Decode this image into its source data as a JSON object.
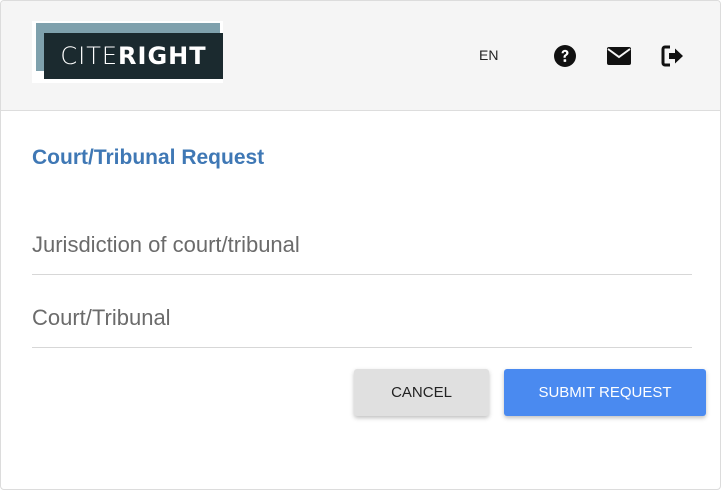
{
  "header": {
    "logo": {
      "text_light": "CITE",
      "text_bold": "RIGHT"
    },
    "language": "EN",
    "icons": [
      "help-icon",
      "mail-icon",
      "logout-icon"
    ]
  },
  "form": {
    "title": "Court/Tribunal Request",
    "jurisdiction_placeholder": "Jurisdiction of court/tribunal",
    "jurisdiction_value": "",
    "court_placeholder": "Court/Tribunal",
    "court_value": "",
    "cancel_label": "CANCEL",
    "submit_label": "SUBMIT REQUEST"
  },
  "colors": {
    "title": "#3f78b5",
    "submit_button": "#4a8af0",
    "cancel_button": "#e0e0e0",
    "header_bg": "#f5f5f5"
  }
}
